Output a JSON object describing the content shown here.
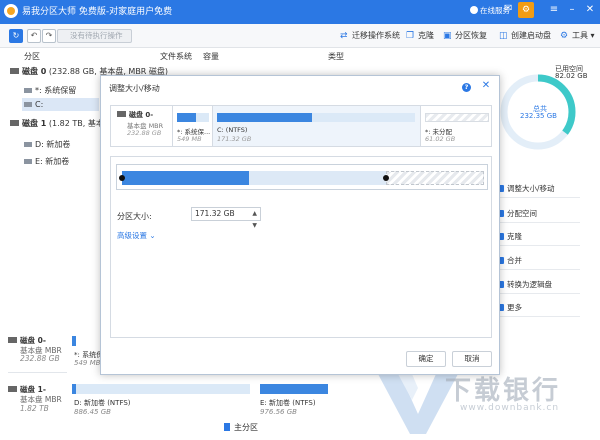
{
  "window": {
    "title": "易我分区大师 免费版-对家庭用户免费",
    "online_service": "在线服务"
  },
  "toolbar": {
    "pending_label": "没有待执行操作",
    "tools": [
      {
        "label": "迁移操作系统"
      },
      {
        "label": "克隆"
      },
      {
        "label": "分区恢复"
      },
      {
        "label": "创建启动盘"
      },
      {
        "label": "工具"
      }
    ]
  },
  "columns": {
    "partition": "分区",
    "filesystem": "文件系统",
    "capacity": "容量",
    "type": "类型"
  },
  "disks_tree": {
    "disk0": {
      "name": "磁盘 0",
      "info": "(232.88 GB, 基本盘, MBR 磁盘)"
    },
    "disk0_parts": [
      "*: 系统保留",
      "C:"
    ],
    "disk1": {
      "name": "磁盘 1",
      "info": "(1.82 TB, 基本盘,"
    },
    "disk1_parts": [
      "D: 新加卷",
      "E: 新加卷"
    ]
  },
  "sidebar": {
    "used_label": "已用空间",
    "used_value": "82.02 GB",
    "total_label": "总共",
    "total_value": "232.35 GB",
    "used_fraction": 0.353,
    "actions": [
      "调整大小/移动",
      "分配空间",
      "克隆",
      "合并",
      "转换为逻辑盘",
      "更多"
    ]
  },
  "bottom_disks": [
    {
      "name": "磁盘 0-",
      "type": "基本盘 MBR",
      "size": "232.88 GB",
      "parts": [
        {
          "label": "*: 系统保留",
          "size": "549 MB"
        }
      ]
    },
    {
      "name": "磁盘 1-",
      "type": "基本盘 MBR",
      "size": "1.82 TB",
      "parts": [
        {
          "label": "D: 新加卷 (NTFS)",
          "size": "886.45 GB"
        },
        {
          "label": "E: 新加卷 (NTFS)",
          "size": "976.56 GB"
        }
      ]
    }
  ],
  "dialog": {
    "title": "调整大小/移动",
    "help": "?",
    "disk": {
      "name": "磁盘 0-",
      "type": "基本盘 MBR",
      "size": "232.88 GB"
    },
    "parts": [
      {
        "label": "*: 系统保...",
        "size": "549 MB",
        "fill": 0.6
      },
      {
        "label": "C: (NTFS)",
        "size": "171.32 GB",
        "fill": 0.48
      },
      {
        "label": "*: 未分配",
        "size": "61.02 GB",
        "fill": 0
      }
    ],
    "size_label": "分区大小:",
    "size_value": "171.32 GB",
    "advanced": "高级设置",
    "ok": "确定",
    "cancel": "取消"
  },
  "legend": {
    "primary": "主分区"
  },
  "watermark": {
    "text": "下载银行",
    "url": "www.downbank.cn"
  },
  "colors": {
    "accent": "#2b78e4",
    "ring": "#3ec9c9"
  }
}
